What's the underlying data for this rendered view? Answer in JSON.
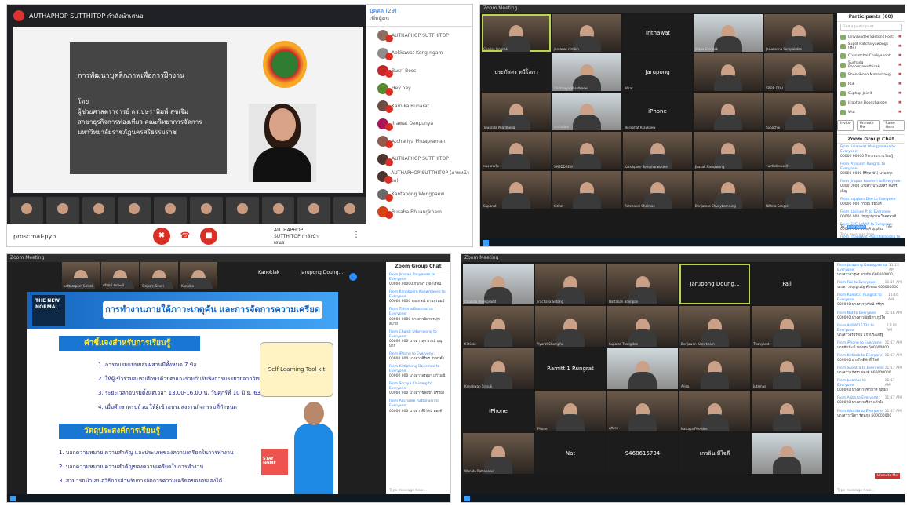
{
  "top_left": {
    "presenter_name": "AUTHAPHOP SUTTHITOP กำลังนำเสนอ",
    "slide_title": "การพัฒนาบุคลิกภาพเพื่อการฝึกงาน",
    "slide_by": "โดย",
    "slide_author": "ผู้ช่วยศาสตราจารย์ ดร.บุษราพิมพ์ สุขเจิม",
    "slide_line1": "สาขาธุรกิจการท่องเที่ยว คณะวิทยาการจัดการ",
    "slide_line2": "มหาวิทยาลัยราชภัฏนครศรีธรรมราช",
    "meeting_code": "pmscmaf-pyh",
    "presenting_label": "AUTHAPHOP SUTTHITOP กำลังนำเสนอ",
    "panel_header": "บุคคล (29)",
    "panel_subheader": "เพิ่มผู้คน",
    "participants": [
      "AUTHAPHOP SUTTHITOP",
      "Aekkawat Kong-ngam",
      "Busri Boss",
      "Hey hey",
      "Karnika Runarat",
      "Jirawat Deepunya",
      "Atchariya Phuapraman",
      "AUTHAPHOP SUTTHITOP",
      "AUTHAPHOP SUTTHITOP (ภาพหน้าจอ)",
      "Kantapong Wongpaew",
      "Busaba Bhuangkham"
    ],
    "avatar_colors": [
      "#8d6e63",
      "#8d8d8d",
      "#c62828",
      "#558b2f",
      "#6d4c41",
      "#ad1457",
      "#8e5a4e",
      "#4e342e",
      "#4e342e",
      "#6a6a6a",
      "#d84315"
    ]
  },
  "top_right": {
    "window_title": "Zoom Meeting",
    "participants_header": "Participants (60)",
    "search_placeholder": "Find a participant",
    "tile_names": [
      "Trithawat",
      "ประภัสสร ทวีโลกา",
      "Jarupong",
      "iPhone"
    ],
    "tile_labels": [
      "Chalisa Jongrak",
      "jantanat nimbin",
      "",
      "Jirapa Chinnak",
      "Jaruwanna Sompakdee",
      "",
      "Chitchaya Wisetkaew",
      "Wirat",
      "",
      "SPIRE ODU",
      "Tawanda Phanthong",
      "นางใจมีสุข",
      "Noraphat Kraykaew",
      "",
      "Supachai",
      "ทนง ทรงใจ",
      "SMEDDREW",
      "Kanokporn Somphanwadee",
      "Jirasak Naruawong",
      "วนาทิพย์ ทองแก้ว",
      "Supanat",
      "Sirirat",
      "Ratchanai Chaimas",
      "Benjamas Chuaybamrung",
      "Nithira Sangsri"
    ],
    "participants": [
      "Jariyavadee Saeton (Host)",
      "Supot Ratchaiyawongs (Me)",
      "Chanatchai Chaliyanont",
      "Suchada Phoomtawuthisak",
      "Boonsiboon Mahasitaeg",
      "Ruk",
      "Suphap Jaiwit",
      "Jiraphan Booncharoen",
      "Wut"
    ],
    "buttons": [
      "Invite",
      "Unmute Me",
      "Raise Hand"
    ],
    "chat_header": "Zoom Group Chat",
    "chat": [
      {
        "from": "From Salahwat Wongpanaya to Everyone:",
        "text": "00000 00000 กิจกรรมการเรียนรู้"
      },
      {
        "from": "From Piyaporn Rungrat to Everyone:",
        "text": "00000 0000 ศิริกุล(ปัจ) นามสกุล"
      },
      {
        "from": "From Jirapon Koomsri to Everyone:",
        "text": "0000 0000 นางสาวประภัสสร จันทร์เพ็ญ"
      },
      {
        "from": "From nopporn Dee to Everyone:",
        "text": "00000 000 ภาวิณี ชัยวงศ์"
      },
      {
        "from": "From Kasinee P. to Everyone:",
        "text": "00000 000 ปัญญานุภาพ ใจอดทนดี"
      },
      {
        "from": "From SUCHANYA to Everyone:",
        "text": "00000 000 วรพงศ์ บุญล้อม"
      },
      {
        "from": "From Thanawut Phatcharapong to Everyone:",
        "text": "00000 000 สุภัทรา ฉายาพรหม"
      }
    ],
    "chat_to_label": "To:",
    "chat_to_value": "Everyone",
    "chat_file": "File",
    "chat_placeholder": "Type message here..."
  },
  "bottom_left": {
    "window_title": "Zoom Meeting",
    "strip_names": [
      "Kanoklak",
      "Jarupong Doung..."
    ],
    "strip_labels": [
      "pattaraporn Sirirat",
      "ศรีรัตน์ ชัยวัฒน์",
      "Siriporn Sinsri",
      "Kannika"
    ],
    "slide_badge": "THE NEW NORMAL",
    "slide_title": "การทำงานภายใต้ภาวะเกตุคัน และการจัดการความเครียด",
    "section1": "คำชี้แจงสำหรับการเรียนรู้",
    "bullets1": [
      "1. การอบรมแบบผสมผสานมีทั้งหมด 7 ข้อ",
      "2. ให้ผู้เข้าร่วมอบรมศึกษาด้วยตนเองร่วมกับรับฟังการบรรยายจากวิทยากร",
      "3. ระยะเวลาอบรมตั้งแต่เวลา 13.00-16.00 น. วันศุกร์ที่ 10 มิ.ย. 63",
      "4. เมื่อศึกษาครบถ้วน ให้ผู้เข้าอบรมส่งงานกิจกรรมที่กำหนด"
    ],
    "toolkit": "Self Learning Tool kit",
    "section2": "วัตถุประสงค์การเรียนรู้",
    "bullets2": [
      "1. บอกความหมาย ความสำคัญ และประเภทของความเครียดในการทำงาน",
      "2. บอกความหมาย ความสำคัญของความเครียดในการทำงาน",
      "3. สามารถนำเสนอวิธีการสำหรับการจัดการความเครียดของตนเองได้"
    ],
    "stay_home": "STAY HOME",
    "chat_header": "Zoom Group Chat",
    "chat": [
      {
        "from": "From Jiranan Panyawan to Everyone:",
        "text": "00000 00000 กนกพร เรืองโรจน์"
      },
      {
        "from": "From Kanokporn Kaewmanee to Everyone:",
        "text": "00000 0000 นงลักษณ์ ผ่านพรหมมี"
      },
      {
        "from": "From Thitima Boonrod to Everyone:",
        "text": "00000 0000 นางสาวปิยาพร สุขสบาย"
      },
      {
        "from": "From Chaisit Udomwong to Everyone:",
        "text": "00000 000 นางสาวสุภาภรณ์ บุญมาก"
      },
      {
        "from": "From iPhone to Everyone:",
        "text": "00000 000 นางสาวศิริพร จันทร์คำ"
      },
      {
        "from": "From Kittiphong Boonmee to Everyone:",
        "text": "00000 000 นางสาวอรอุมา แก้วมณี"
      },
      {
        "from": "From Soraya Klaisang to Everyone:",
        "text": "00000 000 นางสาวชลธิชา ศรีทอง"
      },
      {
        "from": "From Anchalee Rattanasri to Everyone:",
        "text": "00000 000 นางสาวศิริรัตน์ ทองดี"
      }
    ],
    "chat_placeholder": "Type message here..."
  },
  "bottom_right": {
    "window_title": "Zoom Meeting",
    "tile_names": [
      "Jarupong Doung...",
      "Faii",
      "Ramitti1 Rungrat",
      "iPhone",
      "Nat",
      "9468615734",
      "เกวลิน มีใจดี"
    ],
    "tile_labels": [
      "Chanida Kaewpradit",
      "Jirachaya Sritong",
      "Nattakan Boonpan",
      "",
      "",
      "Kittisak",
      "Piyarat Chomphu",
      "Supatra Thongdee",
      "Benjawan Kaewkham",
      "Thanyarat",
      "Kanokwan Sirisuk",
      "",
      "",
      "Arisa",
      "Jutamas",
      "",
      "iPhone",
      "ศุภิสรา",
      "Nattaya Phetdee",
      "",
      "Wanida Rattanakul",
      "",
      "",
      "",
      ""
    ],
    "chat": [
      {
        "from": "From Jarupong Doungpan to Everyone:",
        "text": "นางสาวจารุพร ดวงปัน 600000000"
      },
      {
        "from": "From Faii to Everyone:",
        "text": "นางสาวกัญญาณัฐ คำหอม 600000000"
      },
      {
        "from": "From Ramitti1 Rungrat to Everyone:",
        "text": "000000 นางสาวรุ่งรัตน์ ศรีสุข"
      },
      {
        "from": "From Nat to Everyone:",
        "text": "000000 นางสาวณัฐธิดา ภูมิใจ"
      },
      {
        "from": "From 9468615734 to Everyone:",
        "text": "นางสาวอรวรรณ แก้วประเสริฐ"
      },
      {
        "from": "From iPhone to Everyone:",
        "text": "นายชัยวัฒน์ ทองสุข 600000000"
      },
      {
        "from": "From Kittisak to Everyone:",
        "text": "000000 นายกิตติศักดิ์ ใจดี"
      },
      {
        "from": "From Supatra to Everyone:",
        "text": "นางสาวสุภัทรา ทองดี 600000000"
      },
      {
        "from": "From Jutamas to Everyone:",
        "text": "000000 นางสาวจุฑามาศ บุญมา"
      },
      {
        "from": "From Arisa to Everyone:",
        "text": "000000 นางสาวอริสา แก้วใส"
      },
      {
        "from": "From Wanida to Everyone:",
        "text": "นางสาววนิดา รัตนกุล 600000000"
      }
    ],
    "chat_times": [
      "11:15 AM",
      "11:15 AM",
      "11:16 AM",
      "11:16 AM",
      "11:16 AM",
      "11:17 AM",
      "11:17 AM",
      "11:17 AM",
      "11:17 AM",
      "11:17 AM",
      "11:17 AM"
    ],
    "chat_placeholder": "Type message here...",
    "unmute_tooltip": "Unmute Me"
  }
}
